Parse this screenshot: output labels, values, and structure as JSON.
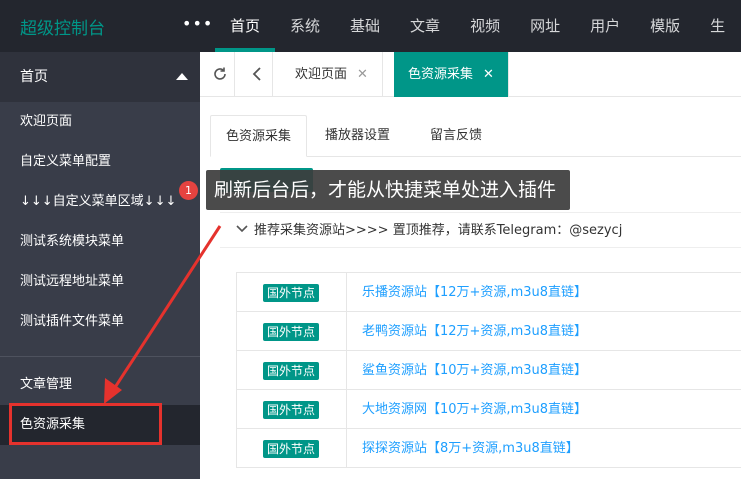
{
  "header": {
    "logo": "超级控制台",
    "menu_toggle": "•••",
    "nav": [
      "首页",
      "系统",
      "基础",
      "文章",
      "视频",
      "网址",
      "用户",
      "模版",
      "生"
    ]
  },
  "sidebar": {
    "header": "首页",
    "items": [
      "欢迎页面",
      "自定义菜单配置",
      "↓↓↓自定义菜单区域↓↓↓",
      "测试系统模块菜单",
      "测试远程地址菜单",
      "测试插件文件菜单"
    ],
    "items2": [
      "文章管理",
      "色资源采集"
    ]
  },
  "page_tabs": {
    "refresh_icon": "refresh-icon",
    "back_icon": "chevron-left-icon",
    "tabs": [
      "欢迎页面",
      "色资源采集"
    ],
    "close": "✕"
  },
  "sub_tabs": [
    "色资源采集",
    "播放器设置",
    "留言反馈"
  ],
  "notice": {
    "text": "推荐采集资源站>>>>  置顶推荐，请联系Telegram：@sezycj"
  },
  "table": {
    "rows": [
      {
        "badge": "国外节点",
        "name": "乐播资源站【12万+资源,m3u8直链】"
      },
      {
        "badge": "国外节点",
        "name": "老鸭资源站【12万+资源,m3u8直链】"
      },
      {
        "badge": "国外节点",
        "name": "鲨鱼资源站【10万+资源,m3u8直链】"
      },
      {
        "badge": "国外节点",
        "name": "大地资源网【10万+资源,m3u8直链】"
      },
      {
        "badge": "国外节点",
        "name": "探探资源站【8万+资源,m3u8直链】"
      }
    ]
  },
  "tooltip": {
    "badge": "1",
    "text": "刷新后台后，才能从快捷菜单处进入插件"
  },
  "colors": {
    "accent": "#009688",
    "topbar": "#23262e",
    "sidebar": "#393d49",
    "link": "#1e9fff",
    "annotation": "#e5322d"
  }
}
